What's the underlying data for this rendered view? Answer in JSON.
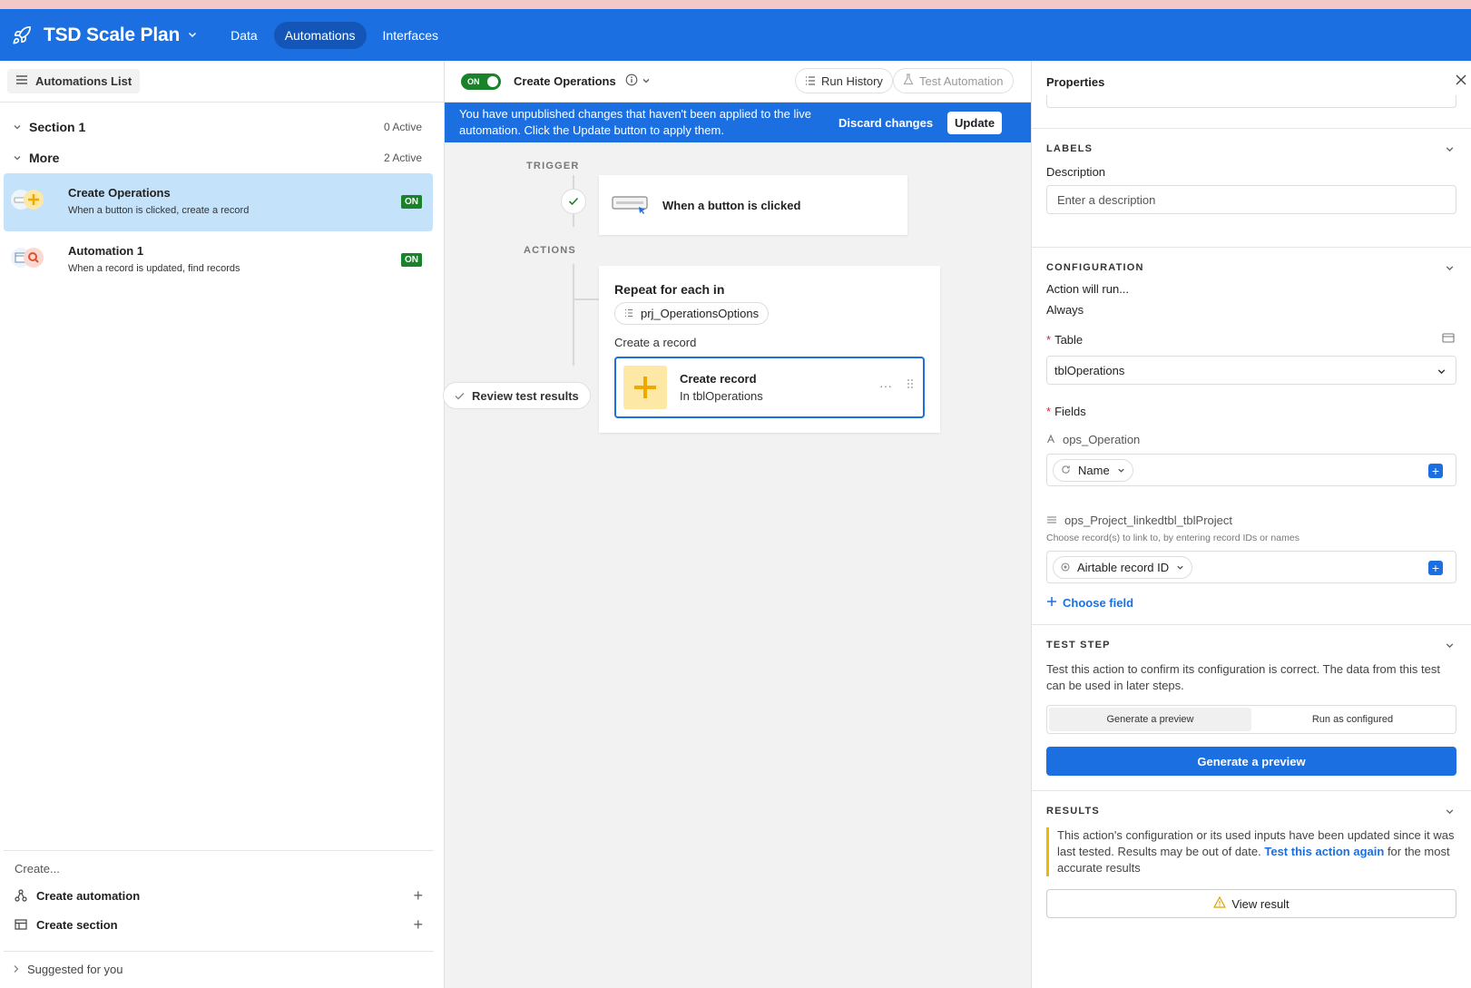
{
  "header": {
    "base_title": "TSD Scale Plan",
    "nav": [
      "Data",
      "Automations",
      "Interfaces"
    ],
    "active_nav": "Automations",
    "colors": {
      "header_bg": "#1b6fe0",
      "accent": "#1b6fe0",
      "on_badge": "#19822b"
    }
  },
  "sidebar": {
    "list_button": "Automations List",
    "sections": [
      {
        "name": "Section 1",
        "count": "0 Active"
      },
      {
        "name": "More",
        "count": "2 Active"
      }
    ],
    "automations": [
      {
        "title": "Create Operations",
        "subtitle": "When a button is clicked, create a record",
        "badge": "ON",
        "icon": "button-plus-icon"
      },
      {
        "title": "Automation 1",
        "subtitle": "When a record is updated, find records",
        "badge": "ON",
        "icon": "table-search-icon"
      }
    ],
    "create_label": "Create...",
    "create_automation": "Create automation",
    "create_section": "Create section",
    "suggested": "Suggested for you"
  },
  "center": {
    "toggle_label": "ON",
    "automation_name": "Create Operations",
    "run_history": "Run History",
    "test_automation": "Test Automation",
    "banner_message": "You have unpublished changes that haven't been applied to the live automation. Click the Update button to apply them.",
    "discard": "Discard changes",
    "update": "Update",
    "trigger_label": "TRIGGER",
    "actions_label": "ACTIONS",
    "trigger_title": "When a button is clicked",
    "repeat_title": "Repeat for each in",
    "repeat_pill": "prj_OperationsOptions",
    "create_a_record": "Create a record",
    "create_record_title": "Create record",
    "create_record_sub": "In tblOperations",
    "review": "Review test results"
  },
  "properties": {
    "title": "Properties",
    "labels_title": "LABELS",
    "description_label": "Description",
    "description_placeholder": "Enter a description",
    "config_title": "CONFIGURATION",
    "action_will_run": "Action will run...",
    "always": "Always",
    "table_label": "Table",
    "table_value": "tblOperations",
    "fields_label": "Fields",
    "field1_name": "ops_Operation",
    "field1_token": "Name",
    "field2_name": "ops_Project_linkedtbl_tblProject",
    "field2_hint": "Choose record(s) to link to, by entering record IDs or names",
    "field2_token": "Airtable record ID",
    "choose_field": "Choose field",
    "test_title": "TEST STEP",
    "test_desc": "Test this action to confirm its configuration is correct. The data from this test can be used in later steps.",
    "seg_preview": "Generate a preview",
    "seg_run": "Run as configured",
    "generate_btn": "Generate a preview",
    "results_title": "RESULTS",
    "results_text_a": "This action's configuration or its used inputs have been updated since it was last tested. Results may be out of date.",
    "results_link": "Test this action again",
    "results_text_b": "for the most accurate results",
    "view_result": "View result"
  }
}
